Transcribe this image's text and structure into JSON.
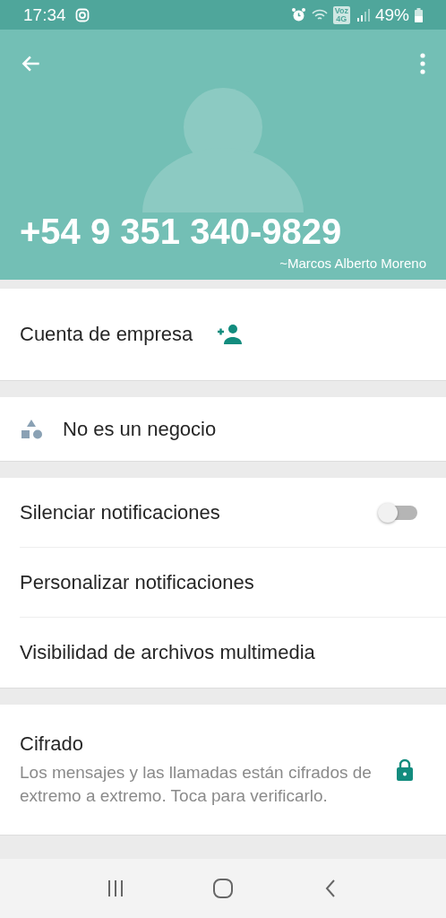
{
  "status_bar": {
    "time": "17:34",
    "volte_badge": [
      "Voz",
      "4G"
    ],
    "battery": "49%"
  },
  "header": {
    "phone": "+54 9 351 340-9829",
    "push_name": "~Marcos Alberto Moreno"
  },
  "business": {
    "label": "Cuenta de empresa"
  },
  "business_status": {
    "label": "No es un negocio"
  },
  "settings": [
    {
      "kind": "toggle",
      "label": "Silenciar notificaciones",
      "on": false
    },
    {
      "kind": "plain",
      "label": "Personalizar notificaciones"
    },
    {
      "kind": "plain",
      "label": "Visibilidad de archivos multimedia"
    }
  ],
  "encryption": {
    "title": "Cifrado",
    "description": "Los mensajes y las llamadas están cifrados de extremo a extremo. Toca para verificarlo."
  }
}
